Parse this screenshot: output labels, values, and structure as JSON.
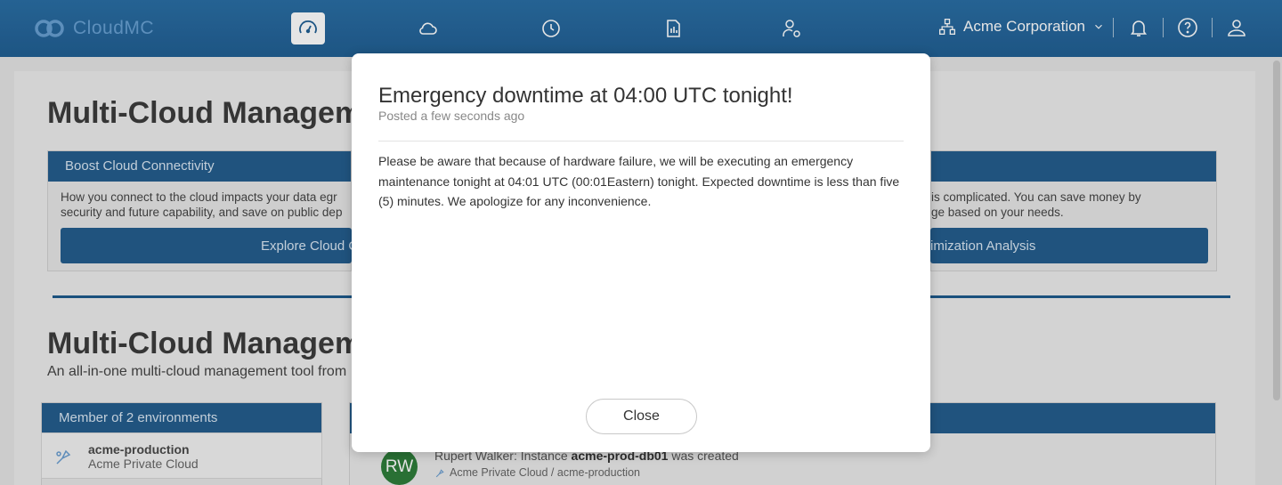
{
  "app": {
    "name": "CloudMC"
  },
  "nav": {
    "icons": [
      "dashboard-icon",
      "cloud-icon",
      "clock-icon",
      "report-icon",
      "user-settings-icon"
    ],
    "org_name": "Acme Corporation"
  },
  "background": {
    "title1": "Multi-Cloud Manageme",
    "title2": "Multi-Cloud Manageme",
    "subtitle": "An all-in-one multi-cloud management tool from",
    "card_left": {
      "header": "Boost Cloud Connectivity",
      "text_line1": "How you connect to the cloud impacts your data egr",
      "text_line2": "security and future capability, and save on public dep",
      "button": "Explore Cloud C"
    },
    "card_right": {
      "text_line1": "is complicated. You can save money by",
      "text_line2": "ge based on your needs.",
      "button": "imization Analysis"
    },
    "environments": {
      "header": "Member of 2 environments",
      "item_name": "acme-production",
      "item_sub": "Acme Private Cloud"
    },
    "activity": {
      "avatar": "RW",
      "line_prefix": "Rupert Walker: Instance",
      "line_instance": "acme-prod-db01",
      "line_suffix": "was created",
      "sub": "Acme Private Cloud / acme-production"
    }
  },
  "modal": {
    "title": "Emergency downtime at 04:00 UTC tonight!",
    "posted": "Posted a few seconds ago",
    "body": "Please be aware that because of hardware failure, we will be executing an emergency maintenance tonight at 04:01 UTC (00:01Eastern) tonight. Expected downtime is less than five (5) minutes. We apologize for any inconvenience.",
    "close_label": "Close"
  },
  "colors": {
    "topbar": "#215f93",
    "accent": "#245d8d",
    "avatar": "#2e7d3a"
  }
}
